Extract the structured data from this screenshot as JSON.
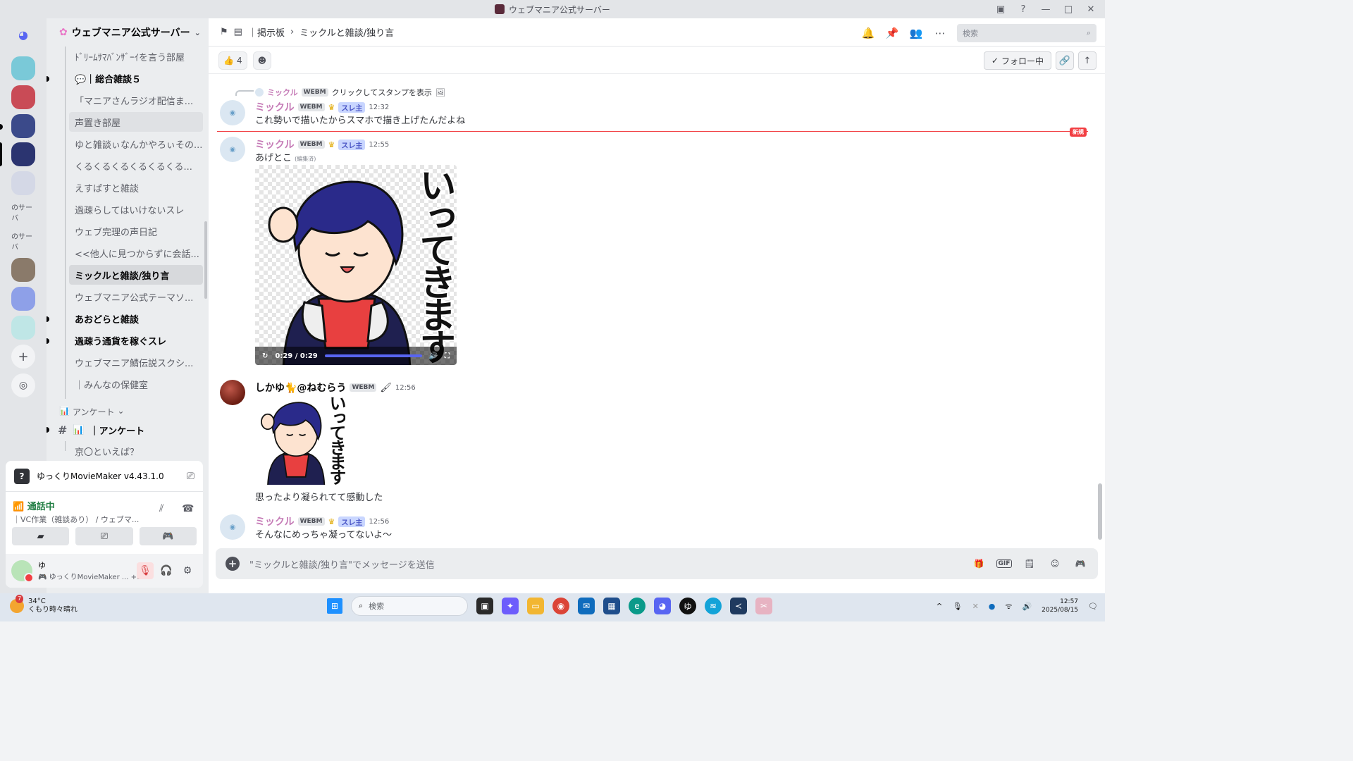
{
  "window": {
    "title": "ウェブマニア公式サーバー"
  },
  "server": {
    "name": "ウェブマニア公式サーバー"
  },
  "guild_labels": {
    "g1": "のサーバ",
    "g2": "のサーバ"
  },
  "channels": [
    {
      "label": "ﾄﾞﾘｰﾑｻﾏﾊﾞﾝｻﾞｰｲを言う部屋"
    },
    {
      "label": "💬｜総合雑談５"
    },
    {
      "label": "「マニアさんラジオ配信ま..."
    },
    {
      "label": "声置き部屋"
    },
    {
      "label": "ゆと雑談ぃなんかやろぃその..."
    },
    {
      "label": "くるくるくるくるくるくる..."
    },
    {
      "label": "えすぱすと雑談"
    },
    {
      "label": "過疎らしてはいけないスレ"
    },
    {
      "label": "ウェブ完理の声日記"
    },
    {
      "label": "<<他人に見つからずに会話..."
    },
    {
      "label": "ミックルと雑談/独り言"
    },
    {
      "label": "ウェブマニア公式テーマソ..."
    },
    {
      "label": "あおどらと雑談"
    },
    {
      "label": "過疎う通貨を稼ぐスレ"
    },
    {
      "label": "ウェブマニア鯖伝説スクシ..."
    },
    {
      "label": "｜みんなの保健室"
    }
  ],
  "category": {
    "label": "アンケート"
  },
  "poll_channel": {
    "label": "｜アンケート"
  },
  "poll_thread": {
    "label": "京〇といえば？"
  },
  "voice": {
    "app": "ゆっくりMovieMaker v4.43.1.0",
    "status": "通話中",
    "location": "｜VC作業（雑談あり） / ウェブマ..."
  },
  "user": {
    "name": "ゆ",
    "activity": "ゆっくりMovieMaker ...",
    "extra": "+1"
  },
  "topbar": {
    "forum": "｜掲示板",
    "thread": "ミックルと雑談/独り言",
    "search_placeholder": "検索"
  },
  "subbar": {
    "reaction_count": "4",
    "follow_label": "フォロー中"
  },
  "messages": [
    {
      "reply_user": "ミックル",
      "reply_tag": "WEBM",
      "reply_text": "クリックしてスタンプを表示",
      "user": "ミックル",
      "tag": "WEBM",
      "badge": "スレ主",
      "time": "12:32",
      "text": "これ勢いで描いたからスマホで描き上げたんだよね"
    },
    {
      "user": "ミックル",
      "tag": "WEBM",
      "badge": "スレ主",
      "time": "12:55",
      "text": "あげとこ",
      "edited": "(編集済)",
      "sticker_text": "いってきます",
      "video_time": "0:29 / 0:29"
    },
    {
      "user": "しかゆ🐈@ねむらう",
      "tag": "WEBM",
      "time": "12:56",
      "sticker_text": "いってきます",
      "text": "思ったより凝られてて感動した"
    },
    {
      "user": "ミックル",
      "tag": "WEBM",
      "badge": "スレ主",
      "time": "12:56",
      "text": "そんなにめっちゃ凝ってないよ〜"
    }
  ],
  "new_badge": "新規",
  "composer": {
    "placeholder": "\"ミックルと雑談/独り言\"でメッセージを送信"
  },
  "taskbar": {
    "temp": "34°C",
    "weather": "くもり時々晴れ",
    "weather_badge": "7",
    "search": "検索",
    "time": "12:57",
    "date": "2025/08/15"
  }
}
